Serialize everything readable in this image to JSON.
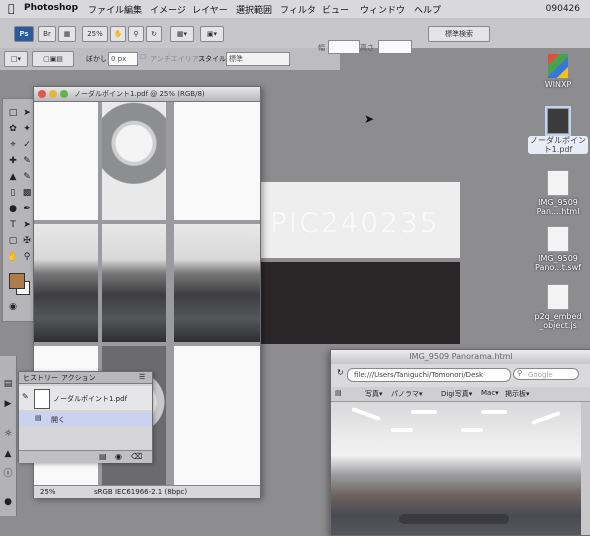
{
  "menubar": {
    "app": "Photoshop",
    "items": [
      "ファイル",
      "編集",
      "イメージ",
      "レイヤー",
      "選択範囲",
      "フィルタ",
      "ビュー",
      "ウィンドウ",
      "ヘルプ"
    ],
    "clock": "090426"
  },
  "appbar": {
    "logo": "Ps",
    "zoom": "25%",
    "search_label": "標準検索"
  },
  "options": {
    "feather_label": "ぼかし",
    "feather_value": "0 px",
    "antialias_label": "アンチエイリアス",
    "style_label": "スタイル",
    "style_value": "標準",
    "width_label": "幅",
    "height_label": "高さ"
  },
  "document": {
    "title": "ノーダルポイント1.pdf @ 25% (RGB/8)",
    "status_zoom": "25%",
    "status_profile": "sRGB IEC61966-2.1 (8bpc)"
  },
  "history": {
    "tab_history": "ヒストリー",
    "tab_actions": "アクション",
    "snapshot_label": "ノーダルポイント1.pdf",
    "step_label": "開く"
  },
  "background_text": "PIC240235",
  "desktop_icons": [
    {
      "label": "WINXP"
    },
    {
      "label": "ノーダルポイント1.pdf"
    },
    {
      "label": "IMG_9509 Pan....html"
    },
    {
      "label": "IMG_9509 Pano...t.swf"
    },
    {
      "label": "p2q_embed _object.js"
    }
  ],
  "browser": {
    "title": "IMG_9509 Panorama.html",
    "url": "file:///Users/Taniguchi/Tomonori/Desk",
    "search_placeholder": "Google",
    "bookmarks": [
      "写真▾",
      "パノラマ▾",
      "Digi写真▾",
      "Mac▾",
      "掲示板▾"
    ]
  },
  "colors": {
    "desktop": "#8d8c8f",
    "foreground_swatch": "#b07b4a",
    "history_selected": "#c9d3f0"
  }
}
